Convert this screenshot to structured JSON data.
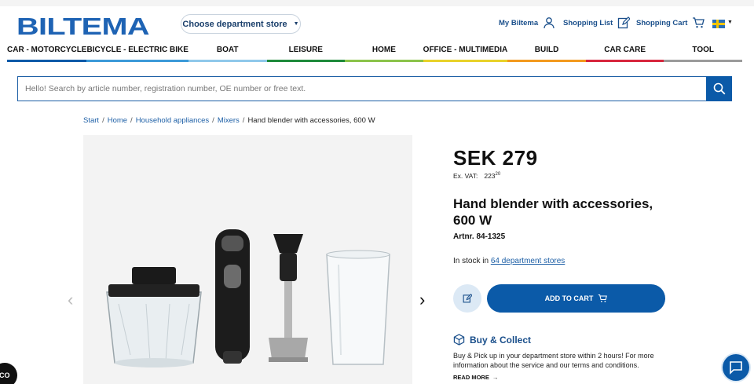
{
  "header": {
    "logo_text": "BILTEMA",
    "store_selector": "Choose department store",
    "my_biltema": "My Biltema",
    "shopping_list": "Shopping List",
    "shopping_cart": "Shopping Cart",
    "language_flag": "sweden-flag-icon"
  },
  "nav": {
    "items": [
      {
        "label": "CAR - MOTORCYCLE",
        "color": "#0b5aa8"
      },
      {
        "label": "BICYCLE - ELECTRIC BIKE",
        "color": "#3c9ad8"
      },
      {
        "label": "BOAT",
        "color": "#8fc8ea"
      },
      {
        "label": "LEISURE",
        "color": "#1f8a3b"
      },
      {
        "label": "HOME",
        "color": "#8bc34a"
      },
      {
        "label": "OFFICE - MULTIMEDIA",
        "color": "#e8d22a"
      },
      {
        "label": "BUILD",
        "color": "#f39a1e"
      },
      {
        "label": "CAR CARE",
        "color": "#d7263d"
      },
      {
        "label": "TOOL",
        "color": "#9b9b9b"
      }
    ]
  },
  "search": {
    "placeholder": "Hello! Search by article number, registration number, OE number or free text."
  },
  "breadcrumb": {
    "items": [
      "Start",
      "Home",
      "Household appliances",
      "Mixers"
    ],
    "current": "Hand blender with accessories, 600 W"
  },
  "product": {
    "price": "SEK 279",
    "ex_vat_label": "Ex. VAT:",
    "ex_vat_value": "223",
    "ex_vat_decimals": "20",
    "title": "Hand blender with accessories, 600 W",
    "artnr": "Artnr. 84-1325",
    "stock_prefix": "In stock in ",
    "stock_link": "64 department stores",
    "add_to_cart": "ADD TO CART"
  },
  "buy_collect": {
    "title": "Buy & Collect",
    "text": "Buy & Pick up in your department store within 2 hours! For more information about the service and our terms and conditions.",
    "read_more": "READ MORE"
  },
  "badge": {
    "co_text": "CO"
  },
  "colors": {
    "brand": "#1e63b4",
    "primary_button": "#0b5aa8"
  }
}
